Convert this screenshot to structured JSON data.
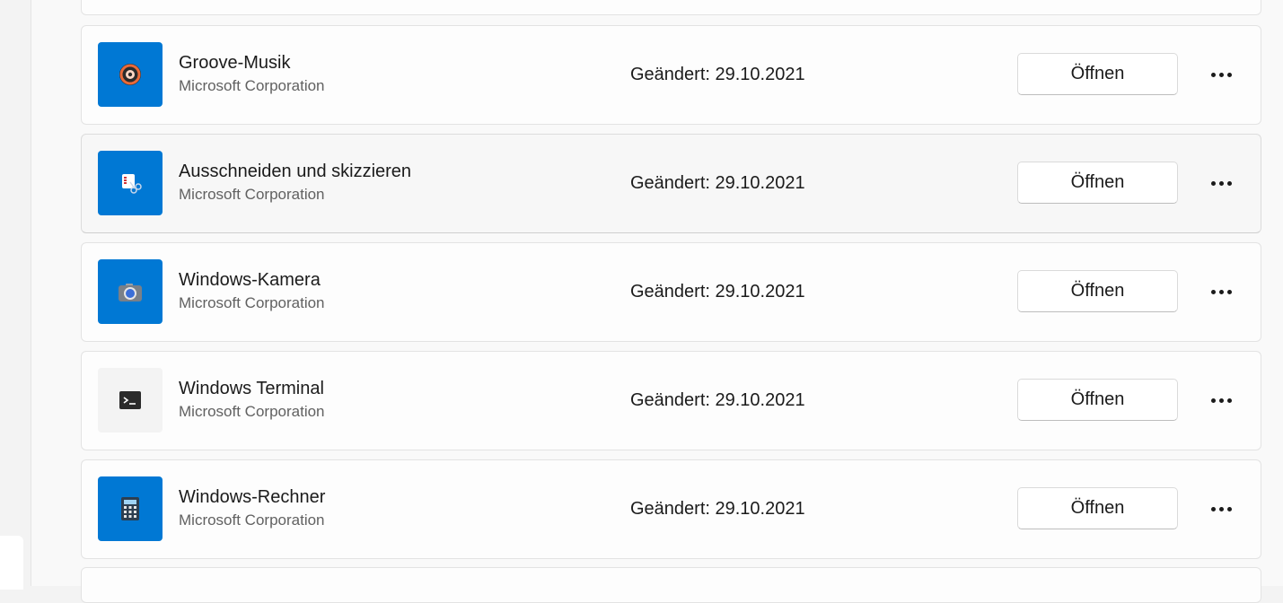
{
  "apps": [
    {
      "name": "Groove-Musik",
      "publisher": "Microsoft Corporation",
      "modified": "Geändert: 29.10.2021",
      "open_label": "Öffnen",
      "icon": "groove-music-icon",
      "icon_bg": "#0078d4"
    },
    {
      "name": "Ausschneiden und skizzieren",
      "publisher": "Microsoft Corporation",
      "modified": "Geändert: 29.10.2021",
      "open_label": "Öffnen",
      "icon": "snip-sketch-icon",
      "icon_bg": "#0078d4"
    },
    {
      "name": "Windows-Kamera",
      "publisher": "Microsoft Corporation",
      "modified": "Geändert: 29.10.2021",
      "open_label": "Öffnen",
      "icon": "camera-icon",
      "icon_bg": "#0078d4"
    },
    {
      "name": "Windows Terminal",
      "publisher": "Microsoft Corporation",
      "modified": "Geändert: 29.10.2021",
      "open_label": "Öffnen",
      "icon": "terminal-icon",
      "icon_bg": "#f3f3f3"
    },
    {
      "name": "Windows-Rechner",
      "publisher": "Microsoft Corporation",
      "modified": "Geändert: 29.10.2021",
      "open_label": "Öffnen",
      "icon": "calculator-icon",
      "icon_bg": "#0078d4"
    }
  ],
  "more_icon": "more-options-icon",
  "accent_color": "#0078d4"
}
